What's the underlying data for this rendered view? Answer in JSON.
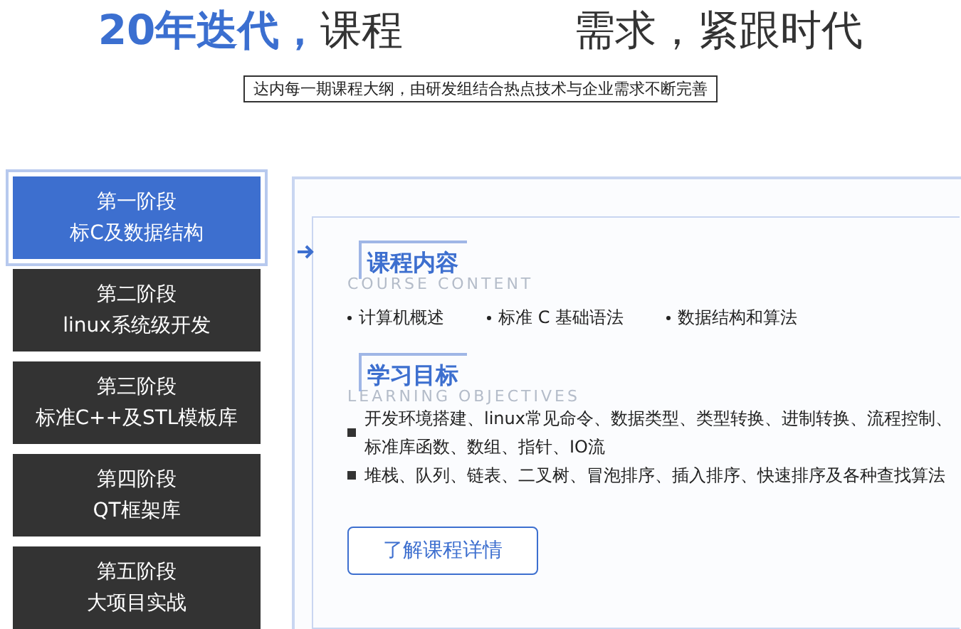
{
  "title": {
    "highlight": "20年迭代，",
    "parts": [
      "课程",
      "需求，紧跟时代"
    ]
  },
  "subtitle": "达内每一期课程大纲，由研发组结合热点技术与企业需求不断完善",
  "stages": [
    {
      "label": "第一阶段",
      "name": "标C及数据结构",
      "selected": true
    },
    {
      "label": "第二阶段",
      "name": "linux系统级开发",
      "selected": false
    },
    {
      "label": "第三阶段",
      "name": "标准C++及STL模板库",
      "selected": false
    },
    {
      "label": "第四阶段",
      "name": "QT框架库",
      "selected": false
    },
    {
      "label": "第五阶段",
      "name": "大项目实战",
      "selected": false
    }
  ],
  "content": {
    "heading": "课程内容",
    "heading_en": "COURSE CONTENT",
    "items": [
      "计算机概述",
      "标准 C 基础语法",
      "数据结构和算法"
    ]
  },
  "objectives": {
    "heading": "学习目标",
    "heading_en": "LEARNING OBJECTIVES",
    "items": [
      "开发环境搭建、linux常见命令、数据类型、类型转换、进制转换、流程控制、标准库函数、数组、指针、IO流",
      "堆栈、队列、链表、二叉树、冒泡排序、插入排序、快速排序及各种查找算法"
    ]
  },
  "button": "了解课程详情"
}
